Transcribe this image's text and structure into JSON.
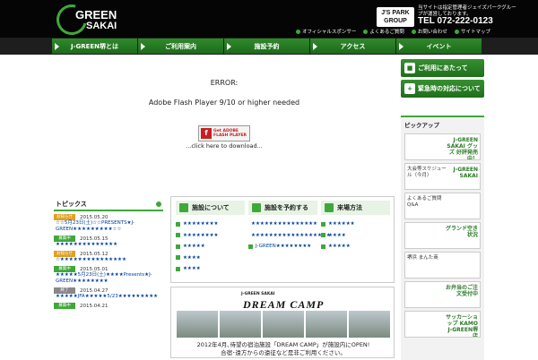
{
  "header": {
    "logo_line1": "GREEN",
    "logo_line2": "SAKAI",
    "partner_badge": "J'S PARK GROUP",
    "note": "当サイトは指定管理者ジェイズパークグループが運営しております。",
    "tel": "TEL 072-222-0123",
    "top_links": [
      "オフィシャルスポンサー",
      "よくあるご質問",
      "お問い合わせ",
      "サイトマップ"
    ]
  },
  "nav": {
    "items": [
      "J-GREEN堺とは",
      "ご利用案内",
      "施設予約",
      "アクセス",
      "イベント"
    ]
  },
  "flash": {
    "error_title": "ERROR:",
    "message": "Adobe Flash Player 9/10 or higher needed",
    "get_button_line1": "Get ADOBE",
    "get_button_line2": "FLASH PLAYER",
    "download_text": "...click here to download..."
  },
  "side_buttons": [
    "ご利用にあたって",
    "緊急時の対応について"
  ],
  "pickup": {
    "title": "ピックアップ",
    "cards": [
      {
        "left": "",
        "right": "J-GREEN SAKAI グッズ 好評発売中！"
      },
      {
        "left": "大会等スケジュール（今月）",
        "right": "J-GREEN SAKAI"
      },
      {
        "left": "よくあるご質問 Q&A",
        "right": ""
      },
      {
        "left": "",
        "right": "グランド空き状況"
      },
      {
        "left": "堺浜 まんた商",
        "right": ""
      },
      {
        "left": "",
        "right": "お弁当のご注文受付中"
      },
      {
        "left": "",
        "right": "サッカーショップ KAMO J-GREEN堺店"
      }
    ]
  },
  "topics": {
    "title": "トピックス",
    "items": [
      {
        "date": "2015.05.20",
        "badge": "お知らせ",
        "badge_color": "#e0a020",
        "text": "☆☆5月23日(土)☆☆PRESENTS★J-GREEN★★★★★★★★★☆☆"
      },
      {
        "date": "2015.05.15",
        "badge": "募集中",
        "badge_color": "#3fa83a",
        "text": "★★★★★★★★★★★★★★"
      },
      {
        "date": "2015.05.12",
        "badge": "お知らせ",
        "badge_color": "#e0a020",
        "text": "☆★★★★★★★★★★★★★★★"
      },
      {
        "date": "2015.05.01",
        "badge": "募集中",
        "badge_color": "#3fa83a",
        "text": "★★★★★5月23日(土)★★★★Presents★J-GREEN★★★★★★★★"
      },
      {
        "date": "2015.04.27",
        "badge": "終了",
        "badge_color": "#888888",
        "text": "★★★★★JFA★★★★★5/23★★★★★★★★★"
      },
      {
        "date": "2015.04.21",
        "badge": "募集中",
        "badge_color": "#3fa83a",
        "text": ""
      }
    ]
  },
  "guide": {
    "columns": [
      {
        "title": "施設について",
        "links": [
          "★★★★★★★★",
          "★★★★★★★★",
          "★★★★★",
          "★★★★",
          "★★★★"
        ]
      },
      {
        "title": "施設を予約する",
        "links": [
          "★★★★★★★★★★★★★★★",
          "★★★★★★★★★★★★★★★★★★",
          "J-GREEN★★★★★★★★"
        ]
      },
      {
        "title": "来場方法",
        "links": [
          "★★★★★★",
          "★★★★",
          "★★★★★"
        ]
      }
    ]
  },
  "dream": {
    "logo": "J-GREEN SAKAI",
    "title": "DREAM CAMP",
    "line1": "2012年4月､待望の宿泊施設「DREAM CAMP」が施設内にOPEN!",
    "line2": "合宿･遠方からの遠征など是非ご利用ください。"
  }
}
